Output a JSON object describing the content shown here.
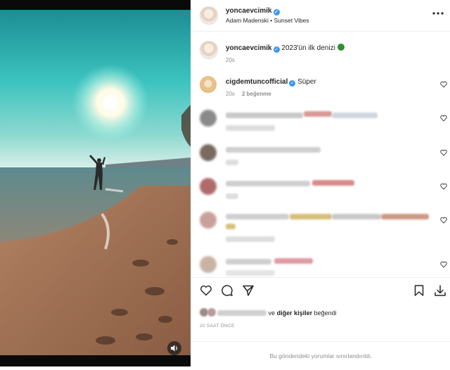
{
  "post": {
    "author": "yoncaevcimik",
    "audio": "Adam Madenski • Sunset Vibes",
    "caption_text": "2023'ün ilk denizi",
    "caption_time": "20s"
  },
  "top_comment": {
    "author": "cigdemtuncofficial",
    "text": "Süper",
    "time": "20s",
    "likes": "2 beğenme"
  },
  "likes_line": {
    "suffix": "ve",
    "others": "diğer kişiler",
    "liked": "beğendi"
  },
  "posted_ago": "20 SAAT ÖNCE",
  "comments_limited": "Bu gönderideki yorumlar sınırlandırıldı.",
  "icons": [
    "more-icon",
    "heart-icon",
    "comment-icon",
    "share-icon",
    "bookmark-icon",
    "download-icon",
    "sound-icon"
  ],
  "colors": {
    "verified": "#3897f0",
    "text": "#262626",
    "muted": "#8e8e8e"
  }
}
